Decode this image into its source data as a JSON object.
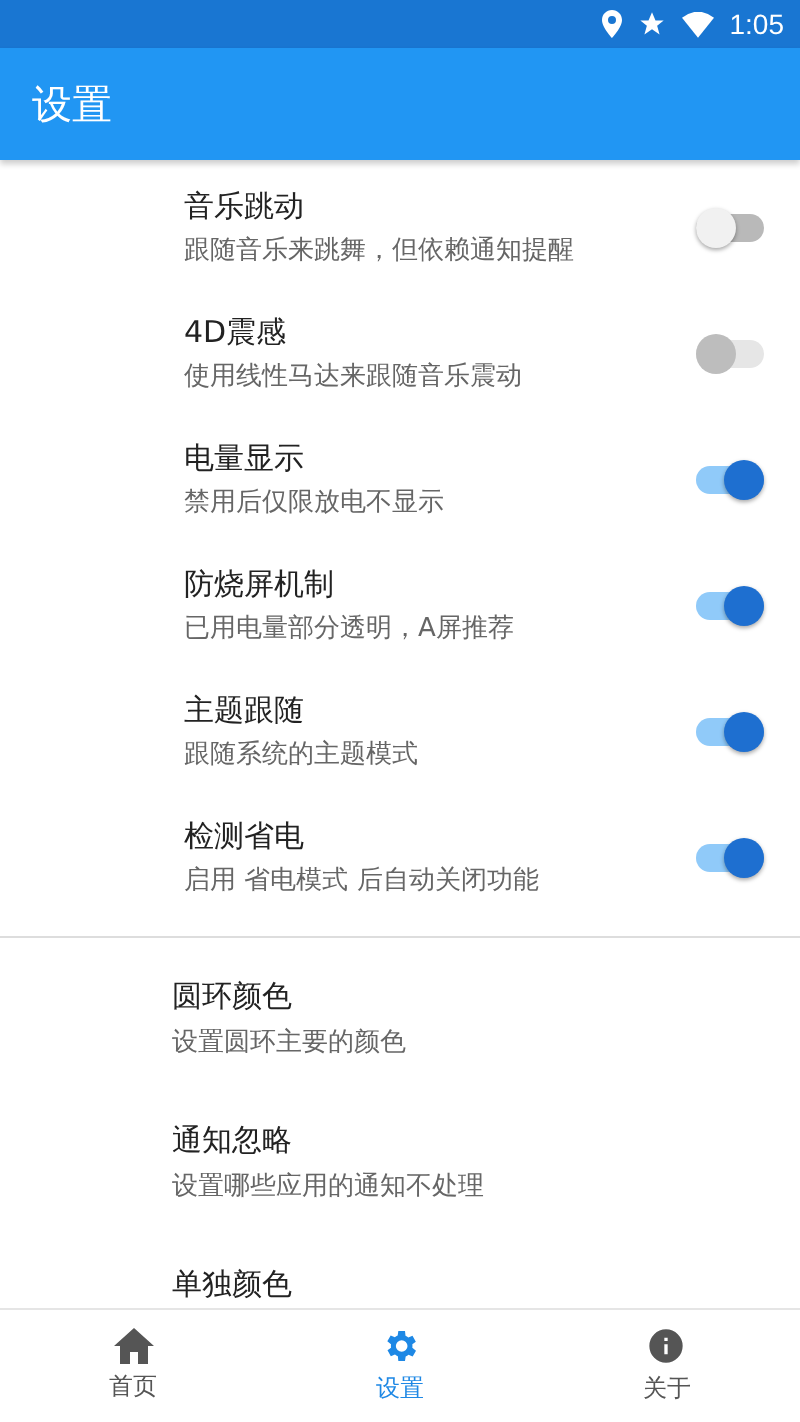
{
  "status_bar": {
    "time": "1:05"
  },
  "app_bar": {
    "title": "设置"
  },
  "switch_settings": [
    {
      "title": "音乐跳动",
      "subtitle": "跟随音乐来跳舞，但依赖通知提醒",
      "on": false,
      "disabled": false
    },
    {
      "title": "4D震感",
      "subtitle": "使用线性马达来跟随音乐震动",
      "on": false,
      "disabled": true
    },
    {
      "title": "电量显示",
      "subtitle": "禁用后仅限放电不显示",
      "on": true,
      "disabled": false
    },
    {
      "title": "防烧屏机制",
      "subtitle": "已用电量部分透明，A屏推荐",
      "on": true,
      "disabled": false
    },
    {
      "title": "主题跟随",
      "subtitle": "跟随系统的主题模式",
      "on": true,
      "disabled": false
    },
    {
      "title": "检测省电",
      "subtitle": "启用 省电模式 后自动关闭功能",
      "on": true,
      "disabled": false
    }
  ],
  "plain_settings": [
    {
      "title": "圆环颜色",
      "subtitle": "设置圆环主要的颜色"
    },
    {
      "title": "通知忽略",
      "subtitle": "设置哪些应用的通知不处理"
    },
    {
      "title": "单独颜色"
    }
  ],
  "bottom_nav": [
    {
      "kind": "home",
      "label": "首页",
      "selected": false
    },
    {
      "kind": "settings",
      "label": "设置",
      "selected": true
    },
    {
      "kind": "about",
      "label": "关于",
      "selected": false
    }
  ]
}
